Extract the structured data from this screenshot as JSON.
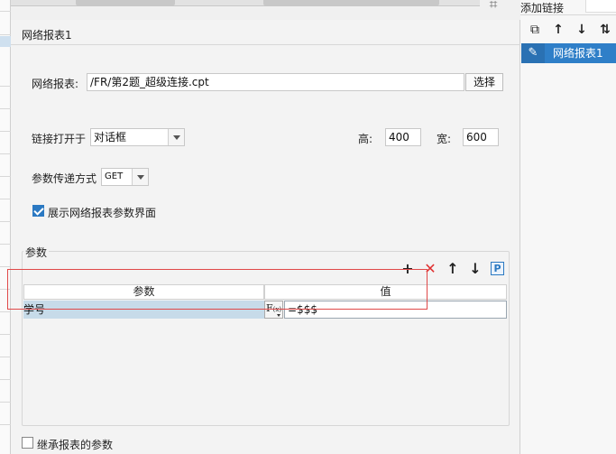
{
  "dialog": {
    "title": "网络报表1"
  },
  "report": {
    "label": "网络报表:",
    "path": "/FR/第2题_超级连接.cpt",
    "choose_button": "选择"
  },
  "link_open": {
    "label": "链接打开于",
    "selected": "对话框",
    "height_label": "高:",
    "height_value": "400",
    "width_label": "宽:",
    "width_value": "600"
  },
  "param_method": {
    "label": "参数传递方式",
    "selected": "GET"
  },
  "show_params": {
    "label": "展示网络报表参数界面",
    "checked": true
  },
  "params_group": {
    "title": "参数",
    "toolbar": {
      "add_icon": "plus-icon",
      "delete_icon": "red-x-icon",
      "up_icon": "arrow-up-icon",
      "down_icon": "arrow-down-icon",
      "param_icon": "P"
    },
    "columns": [
      "参数",
      "值"
    ],
    "rows": [
      {
        "param": "学号",
        "value": "=$$$"
      }
    ],
    "formula_button": "F(x)"
  },
  "inherit": {
    "label": "继承报表的参数",
    "checked": false
  },
  "right_panel": {
    "title": "添加链接",
    "items": [
      {
        "label": "网络报表1"
      }
    ]
  },
  "colors": {
    "selected_blue": "#2f7fc8",
    "row_highlight": "#c7dbe9",
    "annotation_red": "#e04848",
    "delete_red": "#e03030"
  }
}
